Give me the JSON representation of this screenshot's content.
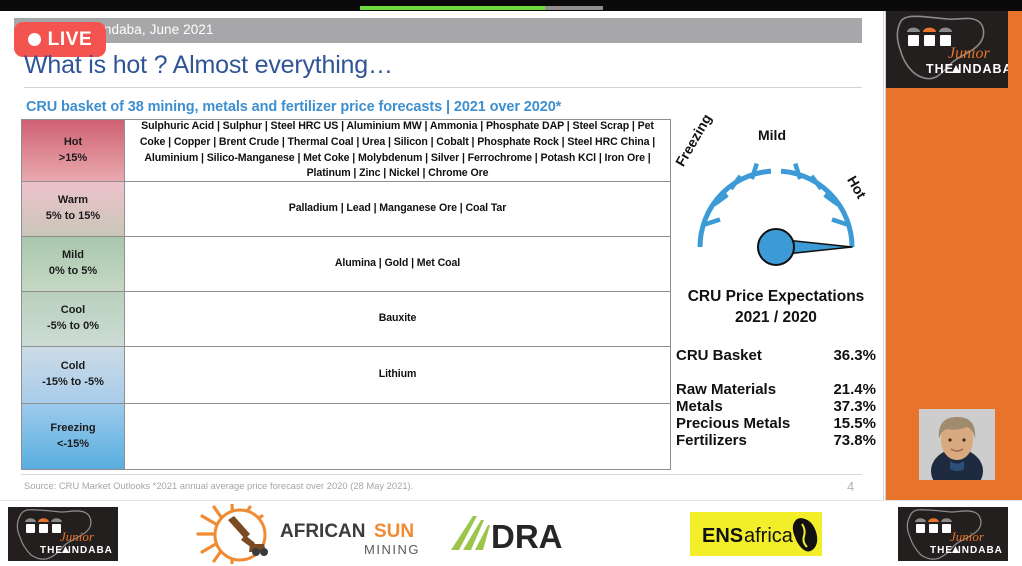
{
  "player": {
    "live_badge_label": "LIVE",
    "progress_percent": 76,
    "buffer_percent": 100
  },
  "slide": {
    "header_bar_text": "Indaba, June 2021",
    "title": "What is hot ? Almost everything…",
    "subtitle": "CRU basket of 38 mining, metals and fertilizer price forecasts | 2021 over 2020*",
    "source_text": "Source: CRU Market Outlooks  *2021 annual average price forecast over 2020 (28 May 2021).",
    "page_number": "4",
    "title_color": "#2f5596",
    "subtitle_color": "#3e8fd0"
  },
  "table": {
    "rows": [
      {
        "label": "Hot",
        "range": ">15%",
        "items": "Sulphuric Acid | Sulphur | Steel HRC US | Aluminium MW | Ammonia | Phosphate DAP | Steel Scrap | Pet Coke | Copper | Brent Crude | Thermal Coal | Urea | Silicon | Cobalt | Phosphate Rock | Steel HRC China | Aluminium | Silico-Manganese | Met Coke | Molybdenum | Silver | Ferrochrome | Potash KCl | Iron Ore | Platinum | Zinc | Nickel | Chrome Ore"
      },
      {
        "label": "Warm",
        "range": "5% to 15%",
        "items": "Palladium | Lead | Manganese Ore | Coal Tar"
      },
      {
        "label": "Mild",
        "range": "0% to 5%",
        "items": "Alumina | Gold | Met Coal"
      },
      {
        "label": "Cool",
        "range": "-5% to 0%",
        "items": "Bauxite"
      },
      {
        "label": "Cold",
        "range": "-15% to -5%",
        "items": "Lithium"
      },
      {
        "label": "Freezing",
        "range": "<-15%",
        "items": ""
      }
    ]
  },
  "gauge": {
    "left_label": "Freezing",
    "center_label": "Mild",
    "right_label": "Hot",
    "needle_position": "hot",
    "arc_color": "#3c9bd6",
    "hub_color": "#3c9bd6"
  },
  "stats": {
    "title_line1": "CRU Price Expectations",
    "title_line2": "2021 / 2020",
    "lead": {
      "label": "CRU Basket",
      "value": "36.3%"
    },
    "rows": [
      {
        "label": "Raw Materials",
        "value": "21.4%"
      },
      {
        "label": "Metals",
        "value": "37.3%"
      },
      {
        "label": "Precious Metals",
        "value": "15.5%"
      },
      {
        "label": "Fertilizers",
        "value": "73.8%"
      }
    ]
  },
  "rail": {
    "background_color": "#e8732b",
    "logo_the": "THE",
    "logo_junior": "Junior",
    "logo_indaba": "INDABA"
  },
  "sponsors": [
    {
      "name": "junior-indaba",
      "the": "THE",
      "junior": "Junior",
      "indaba": "INDABA"
    },
    {
      "name": "african-sun-mining",
      "part1": "AFRICAN",
      "part2": "SUN",
      "sub": "MINING"
    },
    {
      "name": "dra",
      "text": "DRA"
    },
    {
      "name": "ens-africa",
      "part1": "ENS",
      "part2": "africa"
    },
    {
      "name": "junior-indaba-right",
      "the": "THE",
      "junior": "Junior",
      "indaba": "INDABA"
    }
  ]
}
